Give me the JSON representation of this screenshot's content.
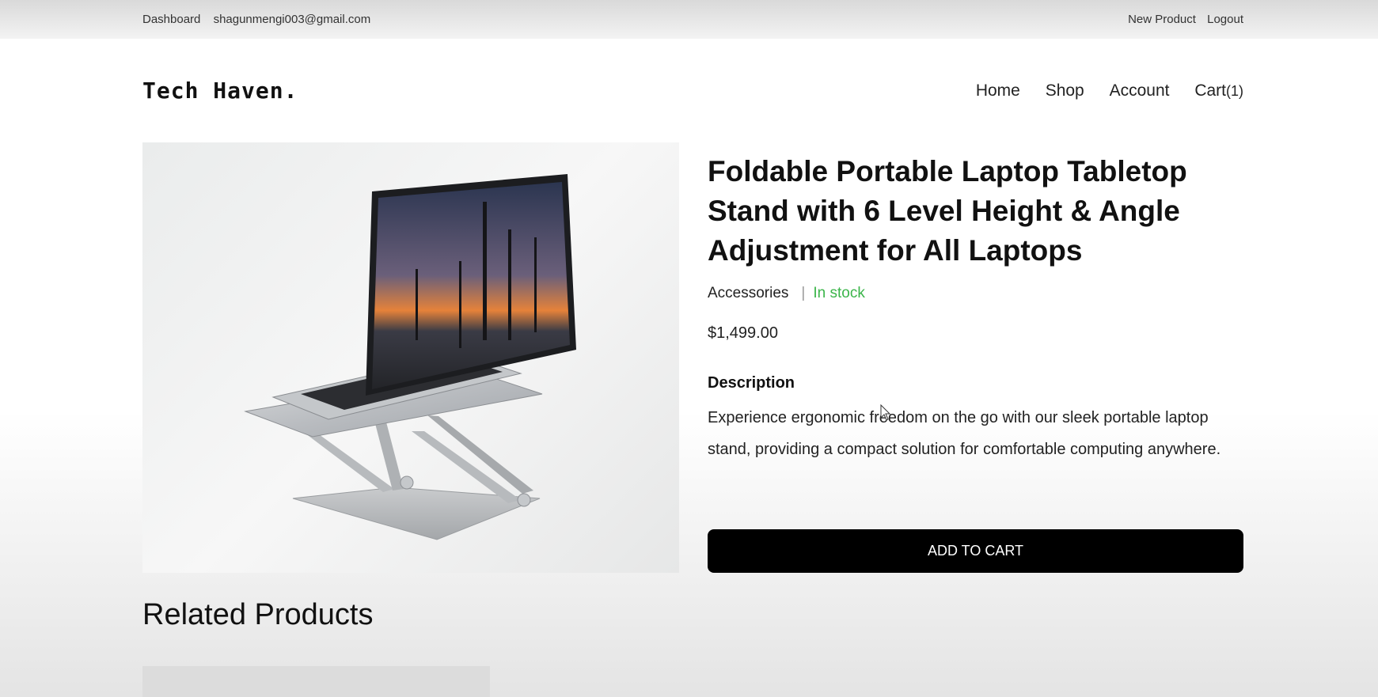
{
  "admin_bar": {
    "dashboard": "Dashboard",
    "email": "shagunmengi003@gmail.com",
    "new_product": "New Product",
    "logout": "Logout"
  },
  "site": {
    "logo": "Tech Haven."
  },
  "nav": {
    "home": "Home",
    "shop": "Shop",
    "account": "Account",
    "cart": "Cart",
    "cart_count": "(1)"
  },
  "product": {
    "image_icon": "laptop-on-stand-image",
    "title": "Foldable Portable Laptop Tabletop Stand with 6 Level Height & Angle Adjustment for All Laptops",
    "category": "Accessories",
    "separator": "|",
    "stock": "In stock",
    "price": "$1,499.00",
    "description_heading": "Description",
    "description": "Experience ergonomic freedom on the go with our sleek portable laptop stand, providing a compact solution for comfortable computing anywhere.",
    "add_to_cart": "ADD TO CART"
  },
  "related": {
    "title": "Related Products"
  },
  "colors": {
    "stock_green": "#3bb54a",
    "button_black": "#000000"
  }
}
